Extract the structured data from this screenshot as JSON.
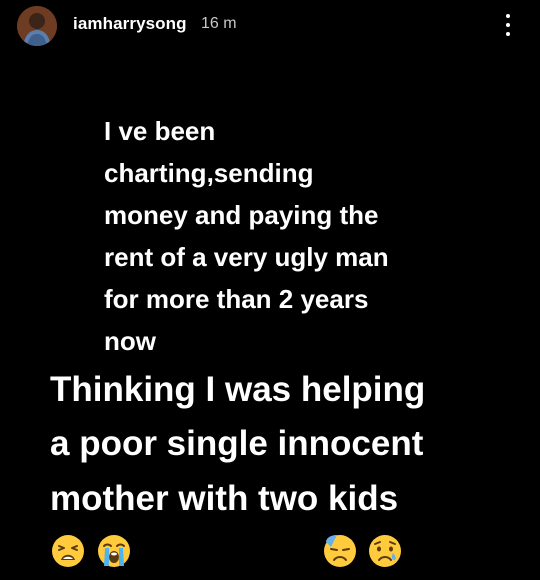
{
  "story": {
    "username": "iamharrysong",
    "time_ago": "16 m"
  },
  "caption": {
    "lines_small": [
      "I ve been",
      "charting,sending",
      "money and paying the",
      "rent of a very ugly man",
      "for more than 2 years",
      "now"
    ],
    "lines_large": [
      "Thinking I was helping",
      "a poor single innocent",
      "mother with two kids"
    ]
  },
  "emojis": [
    "tired-face-icon",
    "loudly-crying-face-icon",
    "downcast-face-with-sweat-icon",
    "sad-but-relieved-face-icon"
  ],
  "colors": {
    "background": "#000000",
    "text": "#ffffff",
    "timestamp": "#c8c8c8",
    "emoji_yellow": "#ffcb3d"
  }
}
